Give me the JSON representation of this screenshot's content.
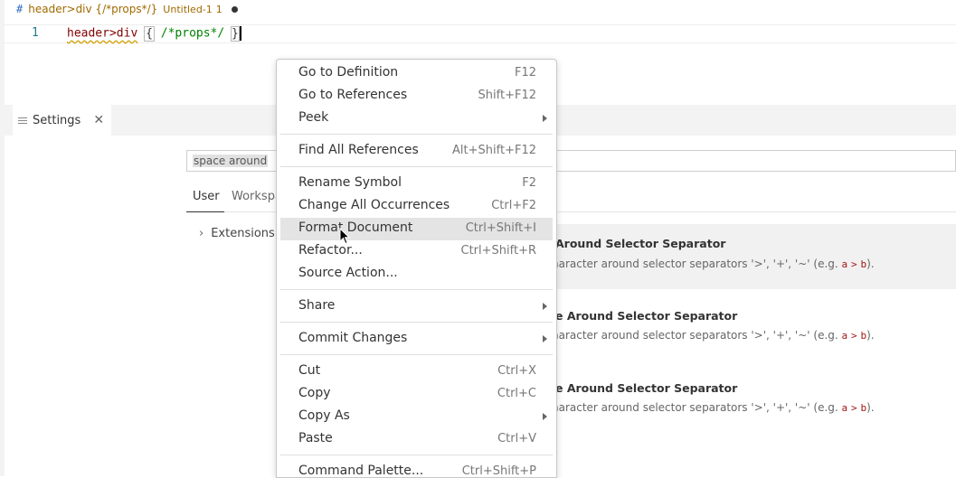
{
  "breadcrumb": {
    "hash": "#",
    "selector": "header>div {/*props*/}",
    "file": "Untitled-1",
    "problems": "1"
  },
  "editor": {
    "line_number": "1",
    "code": {
      "selector": "header>div",
      "brace_open": "{",
      "comment": "/*props*/",
      "brace_close": "}"
    }
  },
  "settings": {
    "tab_label": "Settings",
    "close_glyph": "✕",
    "search_value": "space around",
    "scope_user": "User",
    "scope_workspace": "Workspace",
    "toc_extensions": "Extensions",
    "rows": [
      {
        "title": "Around Selector Separator",
        "desc_text": "haracter around selector separators '>', '+', '~' (e.g. ",
        "a": "a",
        "gt": ">",
        "b": "b",
        "tail": ")."
      },
      {
        "title": "e Around Selector Separator",
        "desc_text": "haracter around selector separators '>', '+', '~' (e.g. ",
        "a": "a",
        "gt": ">",
        "b": "b",
        "tail": ")."
      },
      {
        "title": "e Around Selector Separator",
        "desc_text": "haracter around selector separators '>', '+', '~' (e.g. ",
        "a": "a",
        "gt": ">",
        "b": "b",
        "tail": ")."
      }
    ]
  },
  "context_menu": {
    "items": [
      {
        "label": "Go to Definition",
        "shortcut": "F12"
      },
      {
        "label": "Go to References",
        "shortcut": "Shift+F12"
      },
      {
        "label": "Peek",
        "submenu": true
      },
      {
        "label": "Find All References",
        "shortcut": "Alt+Shift+F12"
      },
      {
        "label": "Rename Symbol",
        "shortcut": "F2"
      },
      {
        "label": "Change All Occurrences",
        "shortcut": "Ctrl+F2"
      },
      {
        "label": "Format Document",
        "shortcut": "Ctrl+Shift+I",
        "hovered": true
      },
      {
        "label": "Refactor...",
        "shortcut": "Ctrl+Shift+R"
      },
      {
        "label": "Source Action..."
      },
      {
        "label": "Share",
        "submenu": true
      },
      {
        "label": "Commit Changes",
        "submenu": true
      },
      {
        "label": "Cut",
        "shortcut": "Ctrl+X"
      },
      {
        "label": "Copy",
        "shortcut": "Ctrl+C"
      },
      {
        "label": "Copy As",
        "submenu": true
      },
      {
        "label": "Paste",
        "shortcut": "Ctrl+V"
      },
      {
        "label": "Command Palette...",
        "shortcut": "Ctrl+Shift+P"
      }
    ]
  }
}
